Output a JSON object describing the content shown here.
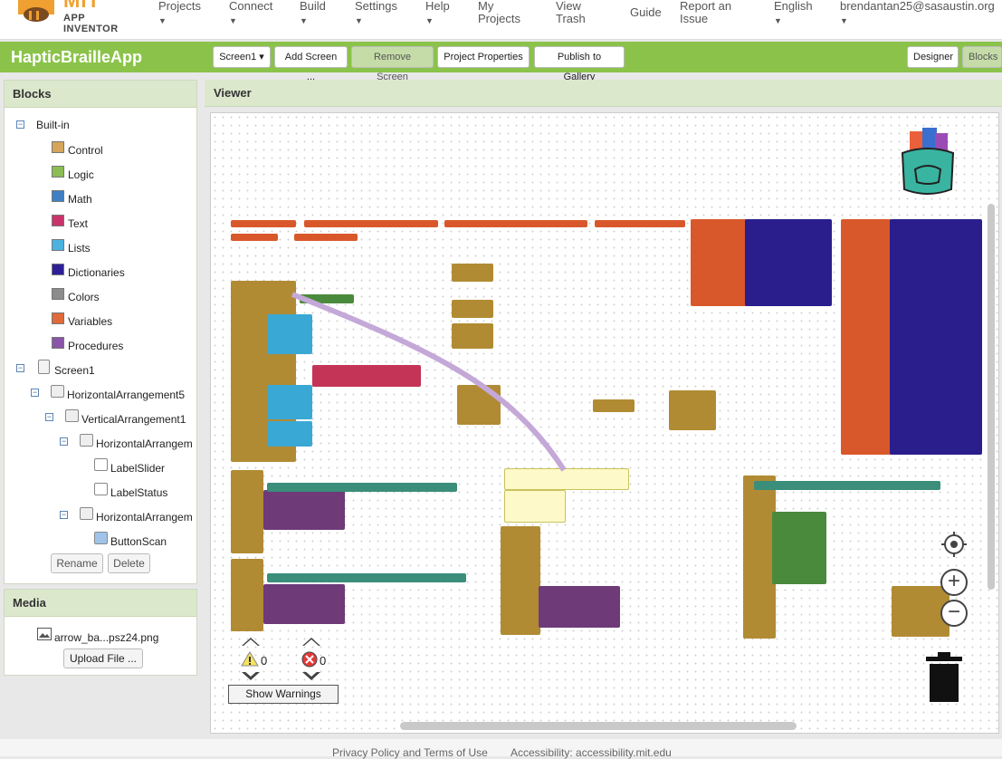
{
  "logo": {
    "title": "MIT",
    "subtitle": "APP INVENTOR"
  },
  "nav": [
    {
      "label": "Projects",
      "caret": true
    },
    {
      "label": "Connect",
      "caret": true
    },
    {
      "label": "Build",
      "caret": true
    },
    {
      "label": "Settings",
      "caret": true
    },
    {
      "label": "Help",
      "caret": true
    },
    {
      "label": "My Projects",
      "caret": false
    },
    {
      "label": "View Trash",
      "caret": false
    },
    {
      "label": "Guide",
      "caret": false
    },
    {
      "label": "Report an Issue",
      "caret": false
    },
    {
      "label": "English",
      "caret": true
    },
    {
      "label": "brendantan25@sasaustin.org",
      "caret": true
    }
  ],
  "toolbar": {
    "app_name": "HapticBrailleApp",
    "screen_select": "Screen1 ▾",
    "add_screen": "Add Screen ...",
    "remove_screen": "Remove Screen",
    "project_properties": "Project Properties",
    "publish": "Publish to Gallery",
    "designer": "Designer",
    "blocks": "Blocks"
  },
  "blocks_panel": {
    "title": "Blocks",
    "builtin_label": "Built-in",
    "categories": [
      {
        "label": "Control",
        "color": "#d4a55a"
      },
      {
        "label": "Logic",
        "color": "#8cbd55"
      },
      {
        "label": "Math",
        "color": "#3f7fc4"
      },
      {
        "label": "Text",
        "color": "#c8346b"
      },
      {
        "label": "Lists",
        "color": "#4cb3e0"
      },
      {
        "label": "Dictionaries",
        "color": "#2d1f96"
      },
      {
        "label": "Colors",
        "color": "#8c8c8c"
      },
      {
        "label": "Variables",
        "color": "#e06a3a"
      },
      {
        "label": "Procedures",
        "color": "#8a55a8"
      }
    ],
    "components": [
      {
        "label": "Screen1"
      },
      {
        "label": "HorizontalArrangement5"
      },
      {
        "label": "VerticalArrangement1"
      },
      {
        "label": "HorizontalArrangem"
      },
      {
        "label": "LabelSlider"
      },
      {
        "label": "LabelStatus"
      },
      {
        "label": "HorizontalArrangem"
      },
      {
        "label": "ButtonScan"
      }
    ],
    "rename": "Rename",
    "delete": "Delete"
  },
  "media_panel": {
    "title": "Media",
    "file": "arrow_ba...psz24.png",
    "upload": "Upload File ..."
  },
  "viewer": {
    "title": "Viewer",
    "warnings_count": "0",
    "errors_count": "0",
    "show_warnings": "Show Warnings"
  },
  "footer": {
    "privacy": "Privacy Policy and Terms of Use",
    "accessibility": "Accessibility: accessibility.mit.edu"
  }
}
